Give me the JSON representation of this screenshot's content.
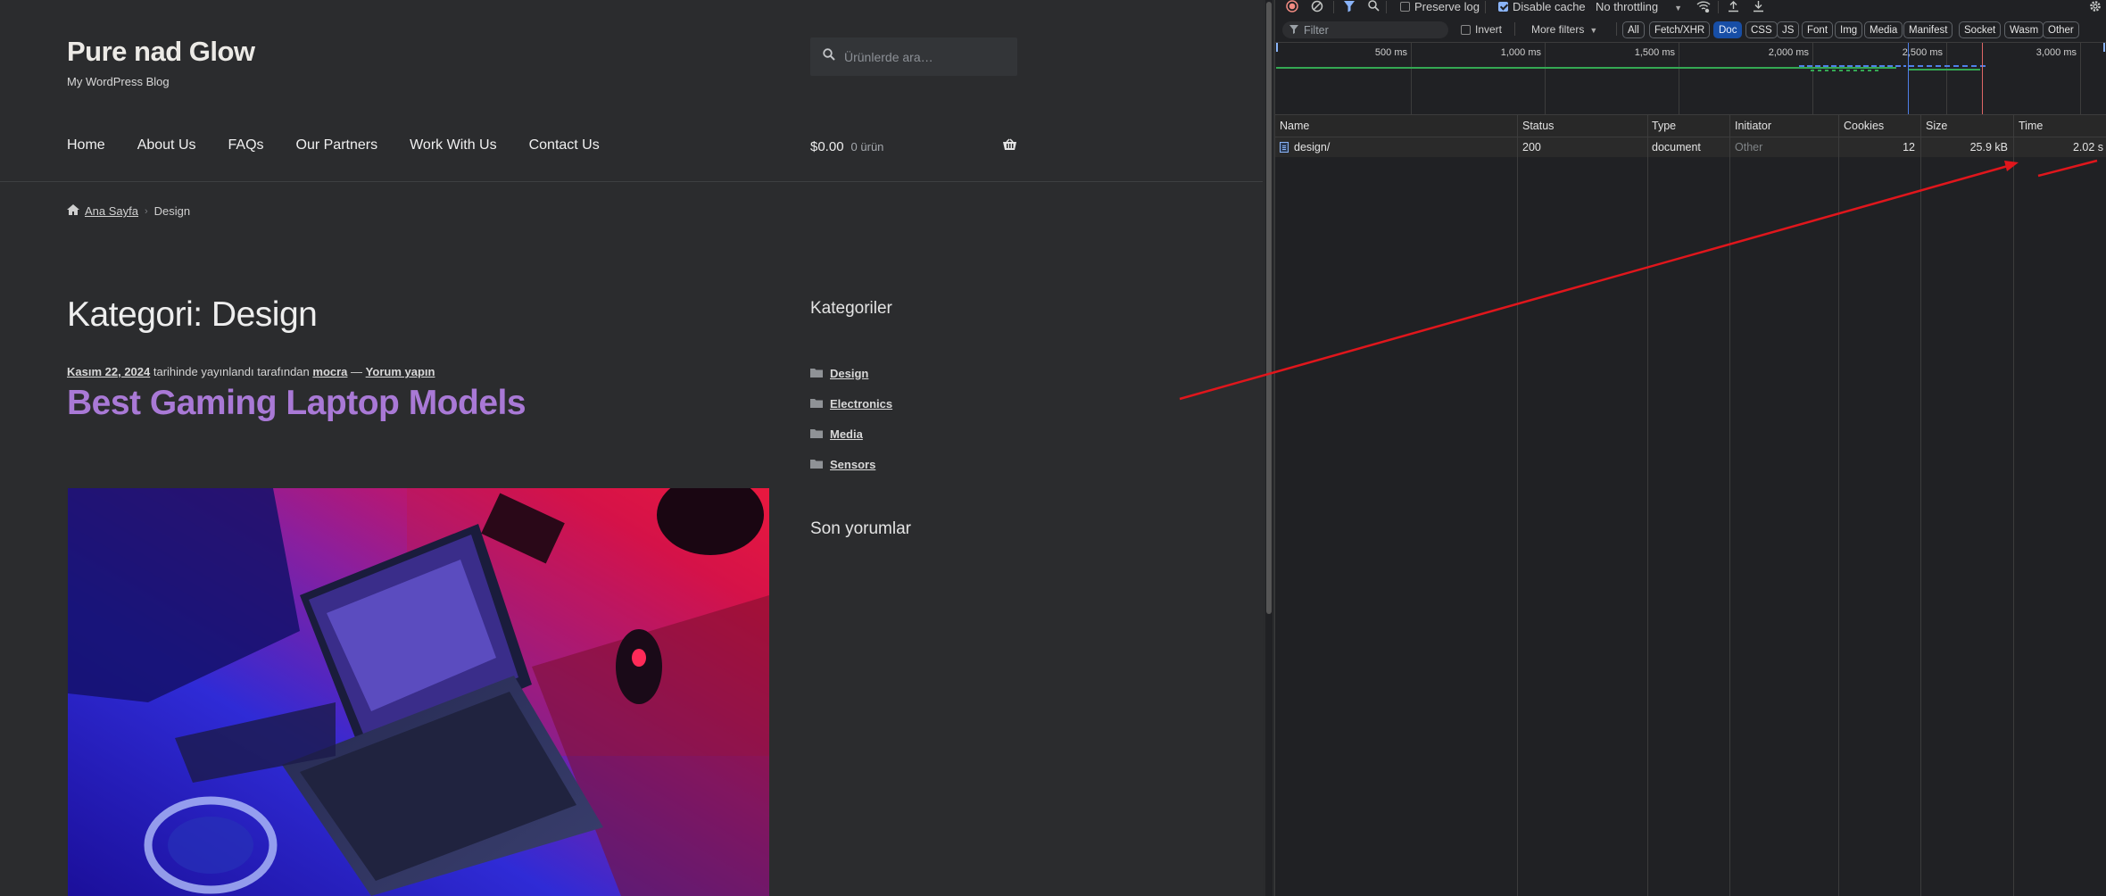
{
  "site": {
    "title": "Pure nad Glow",
    "tagline": "My WordPress Blog",
    "search_placeholder": "Ürünlerde ara…",
    "nav": [
      "Home",
      "About Us",
      "FAQs",
      "Our Partners",
      "Work With Us",
      "Contact Us"
    ],
    "cart": {
      "amount": "$0.00",
      "count": "0 ürün"
    },
    "breadcrumb": {
      "home": "Ana Sayfa",
      "current": "Design"
    },
    "page_title": "Kategori: Design",
    "post_meta": {
      "date": "Kasım 22, 2024",
      "published_text": "tarihinde yayınlandı tarafından",
      "author": "mocra",
      "dash": "—",
      "comment": "Yorum yapın"
    },
    "post_title": "Best Gaming Laptop Models",
    "sidebar": {
      "categories_title": "Kategoriler",
      "categories": [
        "Design",
        "Electronics",
        "Media",
        "Sensors"
      ],
      "recent_comments_title": "Son yorumlar"
    }
  },
  "devtools": {
    "toolbar": {
      "preserve_log": "Preserve log",
      "preserve_log_checked": false,
      "disable_cache": "Disable cache",
      "disable_cache_checked": true,
      "throttling": "No throttling"
    },
    "filter": {
      "placeholder": "Filter",
      "invert": "Invert",
      "more_filters": "More filters",
      "types": [
        "All",
        "Fetch/XHR",
        "Doc",
        "CSS",
        "JS",
        "Font",
        "Img",
        "Media",
        "Manifest",
        "Socket",
        "Wasm",
        "Other"
      ],
      "selected_type": "Doc"
    },
    "timeline_ticks": [
      "500 ms",
      "1,000 ms",
      "1,500 ms",
      "2,000 ms",
      "2,500 ms",
      "3,000 ms"
    ],
    "columns": [
      "Name",
      "Status",
      "Type",
      "Initiator",
      "Cookies",
      "Size",
      "Time"
    ],
    "rows": [
      {
        "name": "design/",
        "status": "200",
        "type": "document",
        "initiator": "Other",
        "cookies": "12",
        "size": "25.9 kB",
        "time": "2.02 s"
      }
    ]
  },
  "colors": {
    "accent_purple": "#a979d6",
    "annotation_red": "#e0161c",
    "selected_pill": "#174ea6"
  }
}
